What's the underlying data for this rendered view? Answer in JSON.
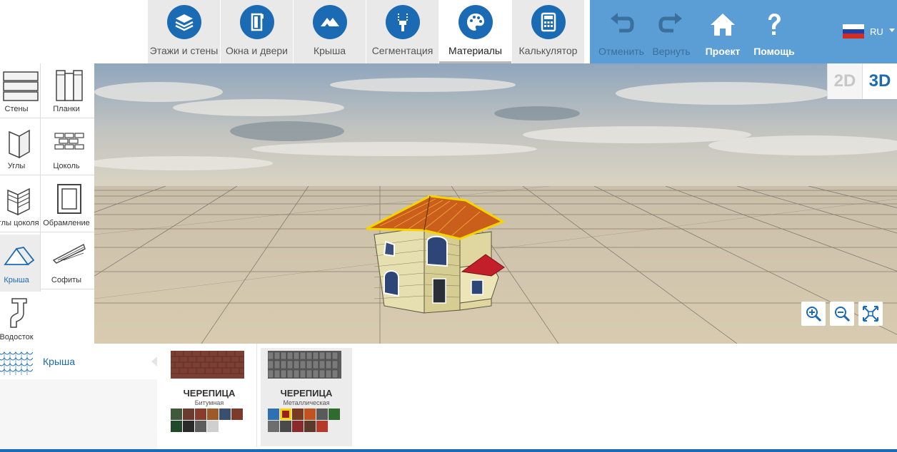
{
  "toolbar": {
    "tabs": [
      {
        "id": "floors",
        "label": "Этажи и стены",
        "icon": "layers-icon"
      },
      {
        "id": "windows",
        "label": "Окна и двери",
        "icon": "door-icon"
      },
      {
        "id": "roof",
        "label": "Крыша",
        "icon": "roof-icon"
      },
      {
        "id": "segmentation",
        "label": "Сегментация",
        "icon": "paint-roller-icon"
      },
      {
        "id": "materials",
        "label": "Материалы",
        "icon": "palette-icon",
        "active": true
      },
      {
        "id": "calculator",
        "label": "Калькулятор",
        "icon": "calculator-icon"
      }
    ],
    "actions": {
      "undo": "Отменить",
      "redo": "Вернуть",
      "project": "Проект",
      "help": "Помощь"
    },
    "language": "RU",
    "accent": "#1b6ab4",
    "bar_color": "#5b9ed6"
  },
  "sidebar": {
    "items": [
      {
        "label": "Стены",
        "icon": "siding-panels-icon"
      },
      {
        "label": "Планки",
        "icon": "trim-strips-icon"
      },
      {
        "label": "Углы",
        "icon": "corner-icon"
      },
      {
        "label": "Цоколь",
        "icon": "brick-icon"
      },
      {
        "label": "Углы цоколя",
        "icon": "plinth-corner-icon"
      },
      {
        "label": "Обрамление",
        "icon": "frame-icon"
      },
      {
        "label": "Крыша",
        "icon": "roof-outline-icon",
        "active": true
      },
      {
        "label": "Софиты",
        "icon": "soffit-icon"
      },
      {
        "label": "Водосток",
        "icon": "gutter-icon"
      }
    ]
  },
  "view": {
    "mode_2d": "2D",
    "mode_3d": "3D",
    "active_mode": "3D",
    "zoom_in": "zoom-in-icon",
    "zoom_out": "zoom-out-icon",
    "fit": "fit-screen-icon"
  },
  "materials": {
    "selected_category": "Крыша",
    "cards": [
      {
        "title": "ЧЕРЕПИЦА",
        "subtitle": "Битумная",
        "swatches": [
          "#3e5a3a",
          "#6a3b2e",
          "#8a3c2c",
          "#9c5a2b",
          "#3a4f6e",
          "#7a3b2a",
          "#1e4a2a",
          "#2a2a2a",
          "#5e5e5e",
          "#cfcfcf"
        ]
      },
      {
        "title": "ЧЕРЕПИЦА",
        "subtitle": "Металлическая",
        "active": true,
        "selected_swatch": 1,
        "swatches": [
          "#2f6fb3",
          "#9a1f1f",
          "#7a3b1f",
          "#c0531f",
          "#5a5a5a",
          "#2f6a2f",
          "#6e6e6e",
          "#4a4a4a",
          "#8a2a2a",
          "#5a3a2a",
          "#b53a2a"
        ]
      }
    ]
  }
}
